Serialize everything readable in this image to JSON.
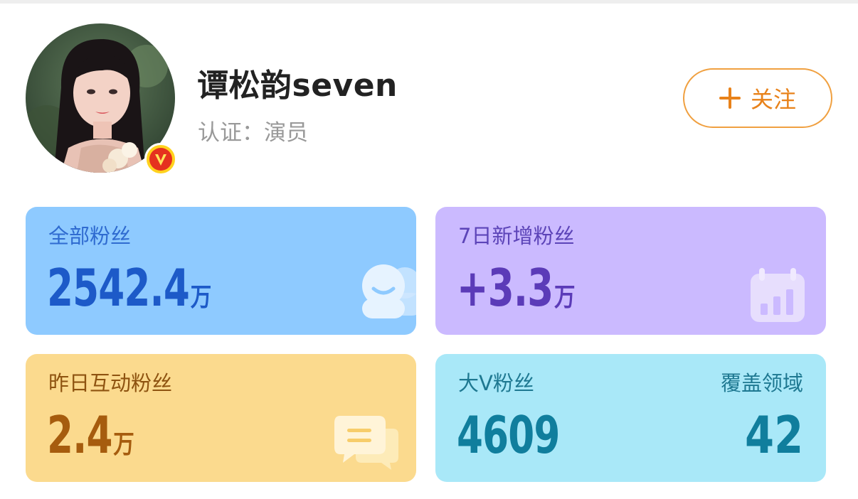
{
  "profile": {
    "name": "谭松韵seven",
    "verification": "认证：演员",
    "verified_badge_icon": "v-badge-icon"
  },
  "follow_button": {
    "label": "关注",
    "icon": "plus-icon",
    "color": "#e8821a"
  },
  "stats": {
    "total_fans": {
      "label": "全部粉丝",
      "value": "2542.4",
      "unit": "万",
      "icon": "fans-icon",
      "color": "#8ecaff"
    },
    "new_fans_7d": {
      "label": "7日新增粉丝",
      "value": "+3.3",
      "unit": "万",
      "icon": "calendar-chart-icon",
      "color": "#cbbaff"
    },
    "interactive_fans_yesterday": {
      "label": "昨日互动粉丝",
      "value": "2.4",
      "unit": "万",
      "icon": "chat-bubble-icon",
      "color": "#fbda8e"
    },
    "big_v_fans": {
      "label": "大V粉丝",
      "value": "4609",
      "color": "#a9e8f8"
    },
    "coverage_fields": {
      "label": "覆盖领域",
      "value": "42"
    }
  }
}
